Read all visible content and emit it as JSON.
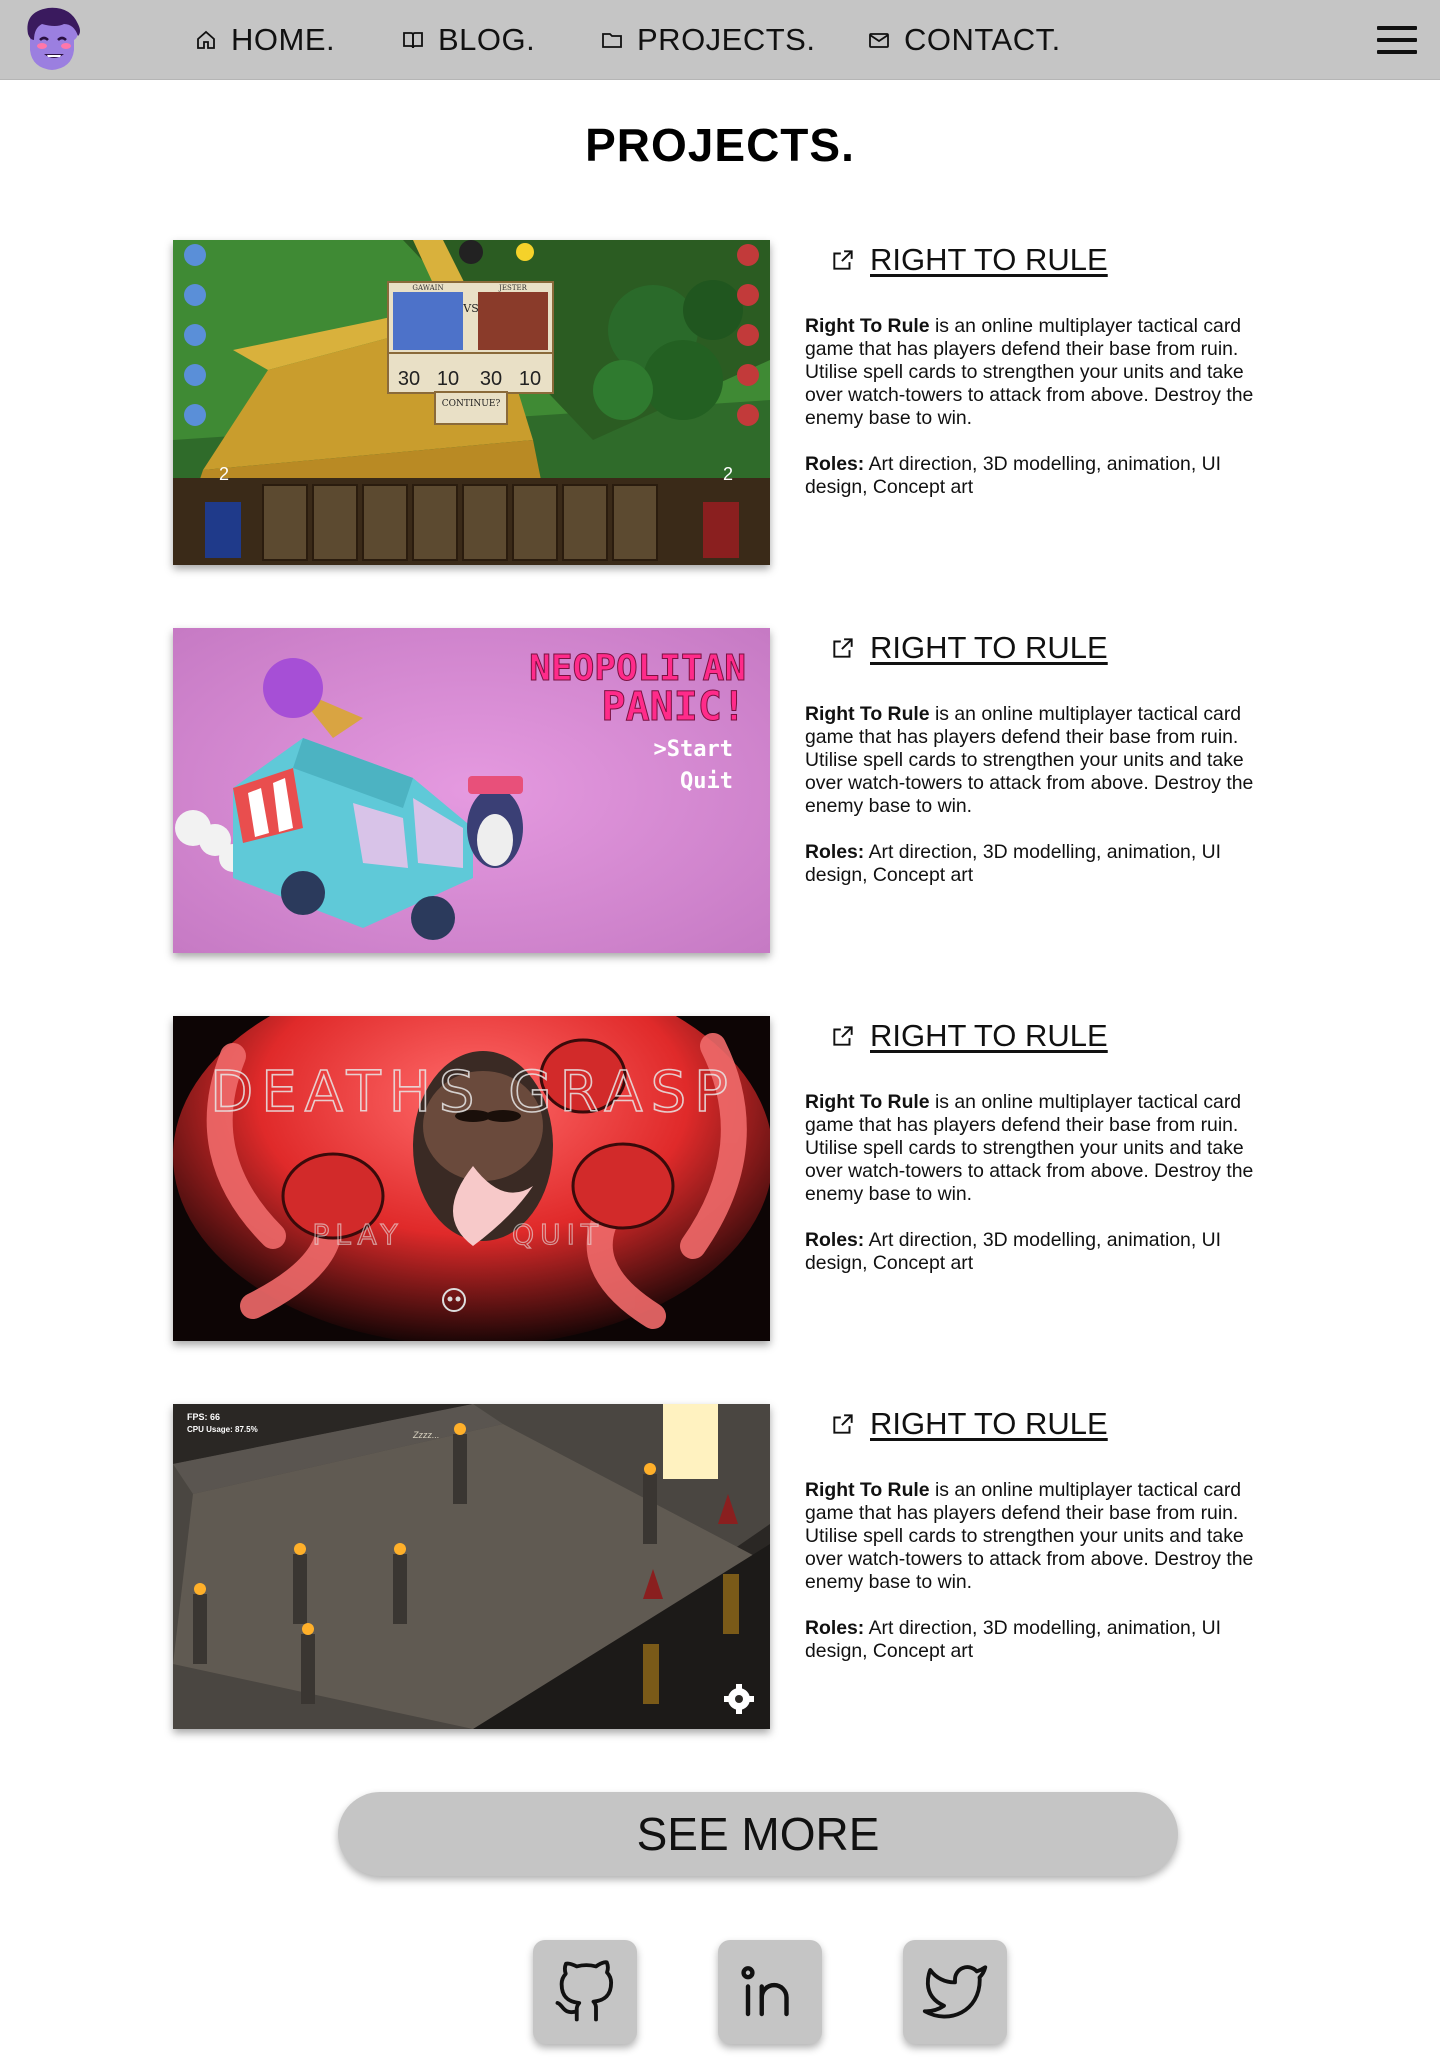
{
  "nav": {
    "items": [
      {
        "label": "HOME.",
        "icon": "home-icon"
      },
      {
        "label": "BLOG.",
        "icon": "book-icon"
      },
      {
        "label": "PROJECTS.",
        "icon": "folder-icon"
      },
      {
        "label": "CONTACT.",
        "icon": "mail-icon"
      }
    ],
    "menu_icon": "hamburger-menu-icon",
    "avatar": "avatar-logo"
  },
  "page": {
    "title": "PROJECTS."
  },
  "projects": [
    {
      "link_label": "RIGHT TO RULE",
      "desc_name": "Right To Rule",
      "desc_text": " is an online multiplayer tactical card game that has players defend their base from ruin. Utilise spell cards to strengthen your units and take over watch-towers to attack from above. Destroy the enemy base to win.",
      "roles_label": "Roles:",
      "roles_text": " Art direction, 3D modelling, animation, UI design, Concept art",
      "image": "right-to-rule-screenshot",
      "image_text": {
        "vs": "VS",
        "continue": "CONTINUE?",
        "left_name": "GAWAIN",
        "right_name": "JESTER",
        "lv_left": "2",
        "lv_right": "2",
        "cards": [
          "30",
          "10",
          "30",
          "10"
        ]
      }
    },
    {
      "link_label": "RIGHT TO RULE",
      "desc_name": "Right To Rule",
      "desc_text": " is an online multiplayer tactical card game that has players defend their base from ruin. Utilise spell cards to strengthen your units and take over watch-towers to attack from above. Destroy the enemy base to win.",
      "roles_label": "Roles:",
      "roles_text": " Art direction, 3D modelling, animation, UI design, Concept art",
      "image": "neopolitan-panic-screenshot",
      "image_text": {
        "title1": "NEOPOLITAN",
        "title2": "PANIC!",
        "start": ">Start",
        "quit": "Quit"
      }
    },
    {
      "link_label": "RIGHT TO RULE",
      "desc_name": "Right To Rule",
      "desc_text": " is an online multiplayer tactical card game that has players defend their base from ruin. Utilise spell cards to strengthen your units and take over watch-towers to attack from above. Destroy the enemy base to win.",
      "roles_label": "Roles:",
      "roles_text": " Art direction, 3D modelling, animation, UI design, Concept art",
      "image": "deaths-grasp-screenshot",
      "image_text": {
        "title": "DEATHS GRASP",
        "play": "PLAY",
        "quit": "QUIT"
      }
    },
    {
      "link_label": "RIGHT TO RULE",
      "desc_name": "Right To Rule",
      "desc_text": " is an online multiplayer tactical card game that has players defend their base from ruin. Utilise spell cards to strengthen your units and take over watch-towers to attack from above. Destroy the enemy base to win.",
      "roles_label": "Roles:",
      "roles_text": " Art direction, 3D modelling, animation, UI design, Concept art",
      "image": "dungeon-screenshot",
      "image_text": {
        "fps": "FPS: 66",
        "cpu": "CPU Usage: 87.5%",
        "zzz": "Zzzz..."
      }
    }
  ],
  "see_more": {
    "label": "SEE MORE"
  },
  "social": [
    {
      "name": "github",
      "icon": "github-icon"
    },
    {
      "name": "linkedin",
      "icon": "linkedin-icon"
    },
    {
      "name": "twitter",
      "icon": "twitter-icon"
    }
  ],
  "colors": {
    "navbar": "#c5c5c5",
    "button": "#c5c5c5",
    "text": "#111111",
    "background": "#ffffff"
  }
}
